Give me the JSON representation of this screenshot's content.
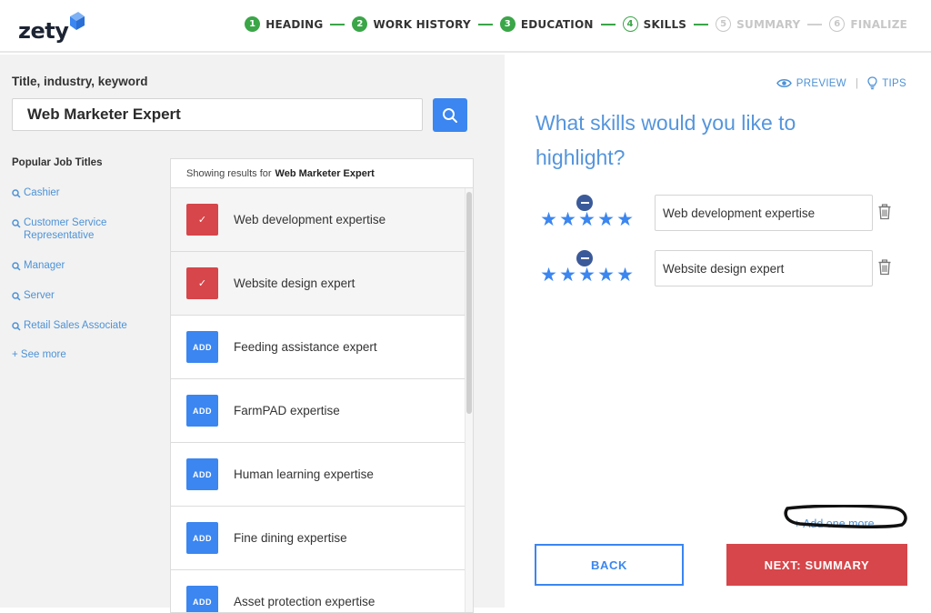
{
  "brand": {
    "logo_text": "zety"
  },
  "steps": [
    {
      "num": "1",
      "label": "HEADING",
      "state": "done"
    },
    {
      "num": "2",
      "label": "WORK HISTORY",
      "state": "done"
    },
    {
      "num": "3",
      "label": "EDUCATION",
      "state": "done"
    },
    {
      "num": "4",
      "label": "SKILLS",
      "state": "current"
    },
    {
      "num": "5",
      "label": "SUMMARY",
      "state": "future"
    },
    {
      "num": "6",
      "label": "FINALIZE",
      "state": "future"
    }
  ],
  "search": {
    "label": "Title, industry, keyword",
    "value": "Web Marketer Expert",
    "button_icon": "search-icon"
  },
  "popular": {
    "title": "Popular Job Titles",
    "items": [
      {
        "label": "Cashier"
      },
      {
        "label": "Customer Service Representative"
      },
      {
        "label": "Manager"
      },
      {
        "label": "Server"
      },
      {
        "label": "Retail Sales Associate"
      }
    ],
    "see_more": "+ See more"
  },
  "results": {
    "prefix": "Showing results for",
    "query": "Web Marketer Expert",
    "add_label": "ADD",
    "check_glyph": "✓",
    "items": [
      {
        "label": "Web development expertise",
        "selected": true
      },
      {
        "label": "Website design expert",
        "selected": true
      },
      {
        "label": "Feeding assistance expert",
        "selected": false
      },
      {
        "label": "FarmPAD expertise",
        "selected": false
      },
      {
        "label": "Human learning expertise",
        "selected": false
      },
      {
        "label": "Fine dining expertise",
        "selected": false
      },
      {
        "label": "Asset protection expertise",
        "selected": false
      }
    ]
  },
  "toolbar": {
    "preview": "PREVIEW",
    "separator": "|",
    "tips": "TIPS"
  },
  "question": "What skills would you like to highlight?",
  "skills": [
    {
      "value": "Web development expertise",
      "rating": 5,
      "rating_max": 5
    },
    {
      "value": "Website design expert",
      "rating": 5,
      "rating_max": 5
    }
  ],
  "add_more": "+ Add one more",
  "buttons": {
    "back": "BACK",
    "next": "NEXT: SUMMARY"
  },
  "colors": {
    "brand_blue": "#3b86f0",
    "step_green": "#3aa648",
    "accent_red": "#d6464a",
    "link_blue": "#4d92d6"
  }
}
